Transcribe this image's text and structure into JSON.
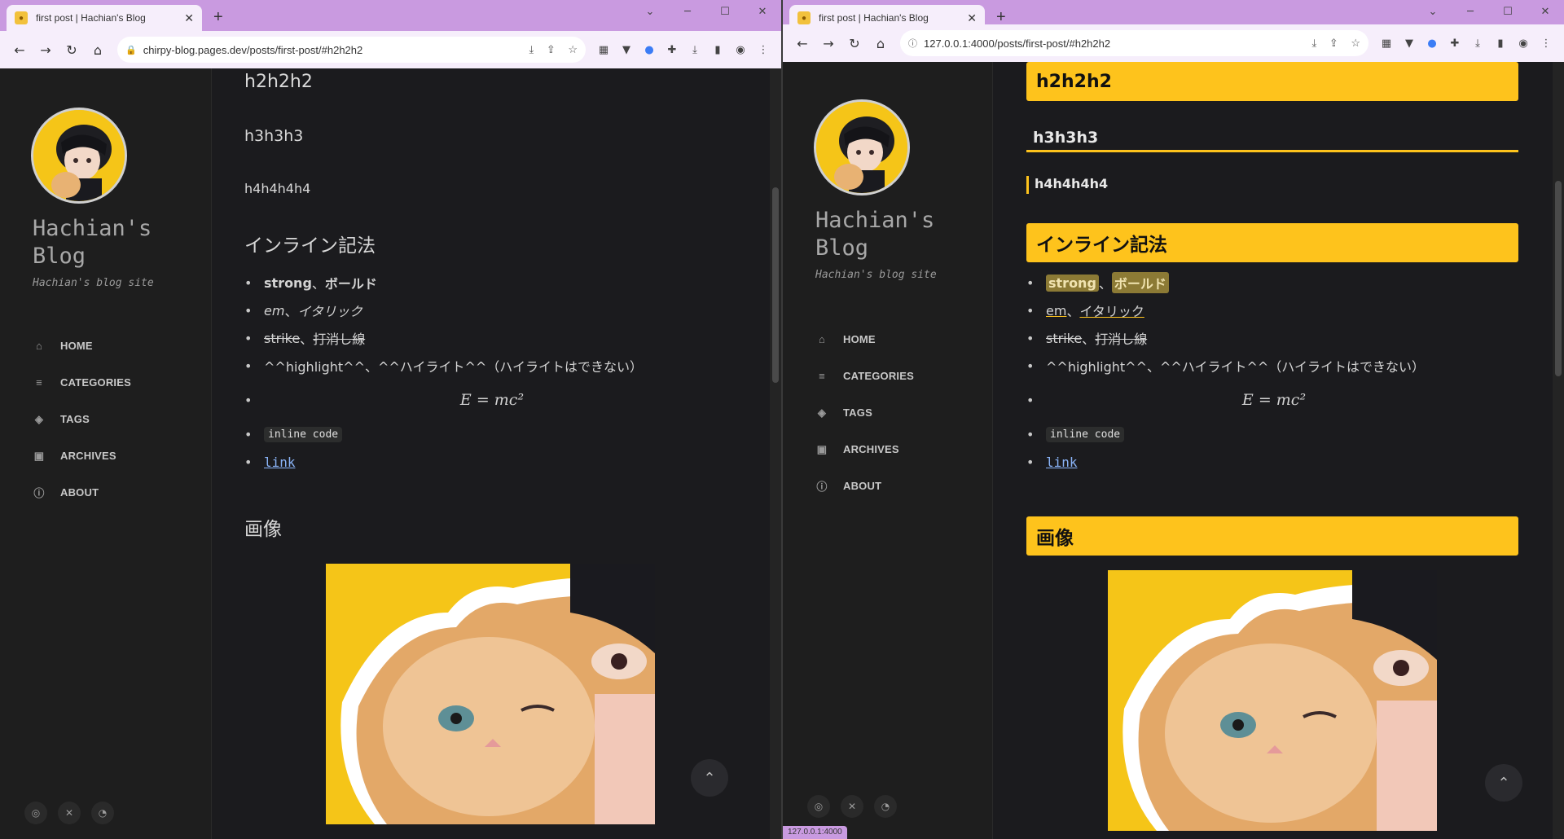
{
  "tab_title": "first post | Hachian's Blog",
  "left": {
    "url": "chirpy-blog.pages.dev/posts/first-post/#h2h2h2"
  },
  "right": {
    "url": "127.0.0.1:4000/posts/first-post/#h2h2h2",
    "status_url": "127.0.0.1:4000"
  },
  "sidebar": {
    "title": "Hachian's Blog",
    "subtitle": "Hachian's blog site",
    "nav": [
      {
        "label": "HOME",
        "icon": "home-icon"
      },
      {
        "label": "CATEGORIES",
        "icon": "list-icon"
      },
      {
        "label": "TAGS",
        "icon": "tags-icon"
      },
      {
        "label": "ARCHIVES",
        "icon": "archive-icon"
      },
      {
        "label": "ABOUT",
        "icon": "info-icon"
      }
    ]
  },
  "post": {
    "h2": "h2h2h2",
    "h3": "h3h3h3",
    "h4": "h4h4h4h4",
    "inline_heading": "インライン記法",
    "strong_a": "strong",
    "sep": "、",
    "strong_b": "ボールド",
    "em_a": "em",
    "em_b": "イタリック",
    "strike_a": "strike",
    "strike_b": "打消し線",
    "highlight_line": "^^highlight^^、^^ハイライト^^（ハイライトはできない）",
    "math": "E = mc²",
    "code": "inline code",
    "link": "link",
    "image_heading": "画像"
  },
  "colors": {
    "tab_strip": "#c99ae0",
    "toolbar": "#f6eefb",
    "page_bg": "#1b1b1e",
    "heading_accent": "#fec31c",
    "link": "#8ab4f8"
  }
}
